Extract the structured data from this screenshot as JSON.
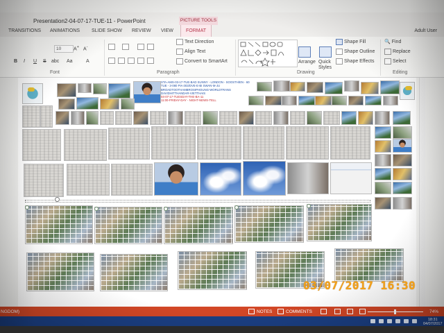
{
  "window": {
    "title": "Presentation2-04-07-17-TUE-11 - PowerPoint",
    "context_group": "PICTURE TOOLS"
  },
  "tabs": [
    {
      "label": "TRANSITIONS"
    },
    {
      "label": "ANIMATIONS"
    },
    {
      "label": "SLIDE SHOW"
    },
    {
      "label": "REVIEW"
    },
    {
      "label": "VIEW"
    },
    {
      "label": "FORMAT",
      "active": true
    }
  ],
  "user": {
    "name": "Adult User"
  },
  "ribbon": {
    "font_group_label": "Font",
    "font_size": "10",
    "paragraph_group_label": "Paragraph",
    "drawing_group_label": "Drawing",
    "editing_group_label": "Editing",
    "text_direction": "Text Direction",
    "align_text": "Align Text",
    "convert_smartart": "Convert to SmartArt",
    "arrange": "Arrange",
    "quick_styles": "Quick Styles",
    "shape_fill": "Shape Fill",
    "shape_outline": "Shape Outline",
    "shape_effects": "Shape Effects",
    "find": "Find",
    "replace": "Replace",
    "select": "Select"
  },
  "slide": {
    "text_lines": [
      "STA-AMS-03-17-TUE-BAD SUNNY - LONDON - SOOSTH/EN - 6082",
      "TUE - 3-080 PIA 003/DVE-E-BI SWAN-M-JU",
      "BROADTOOTHAMBROSIPHOUNG-WORLDTRANS",
      "DAVIDHITTHANDAR-VIETTHAIS",
      "04-07-17-TUESDAY-THE-BA-11",
      "11:00-FRIDAY-DAY - NIGHT-NEWS-TELL"
    ]
  },
  "statusbar": {
    "language": "NGDOM)",
    "notes": "NOTES",
    "comments": "COMMENTS",
    "zoom": "74%"
  },
  "taskbar": {
    "time": "18:31",
    "date": "04/07/2017"
  },
  "camera_stamp": {
    "date": "03/07/2017",
    "time": "16:30"
  },
  "colors": {
    "accent": "#d24726",
    "context_tab": "#b5354b",
    "taskbar": "#1b3f83",
    "stamp": "#f3a118"
  }
}
